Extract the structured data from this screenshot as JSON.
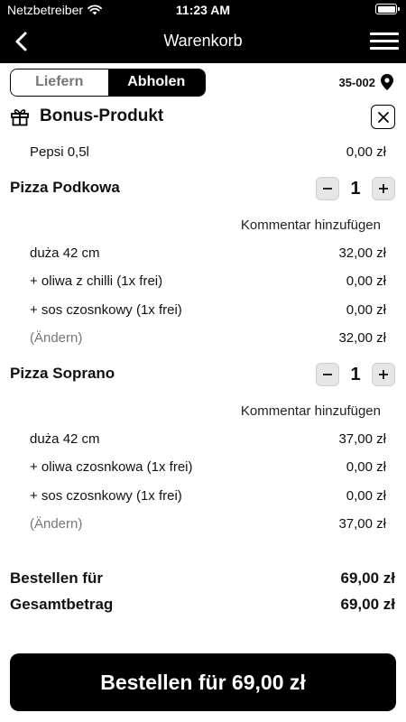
{
  "status": {
    "carrier": "Netzbetreiber",
    "time": "11:23 AM"
  },
  "nav": {
    "title": "Warenkorb"
  },
  "mode": {
    "deliver": "Liefern",
    "pickup": "Abholen",
    "selected": "pickup",
    "postal_code": "35-002"
  },
  "bonus": {
    "title": "Bonus-Produkt",
    "item": {
      "name": "Pepsi 0,5l",
      "price": "0,00 zł"
    }
  },
  "products": [
    {
      "name": "Pizza Podkowa",
      "qty": "1",
      "comment": "Kommentar hinzufügen",
      "lines": [
        {
          "label": "duża 42 cm",
          "price": "32,00 zł"
        },
        {
          "label": "+ oliwa z chilli (1x frei)",
          "price": "0,00 zł"
        },
        {
          "label": "+ sos czosnkowy (1x frei)",
          "price": "0,00 zł"
        },
        {
          "label": "(Ändern)",
          "price": "32,00 zł"
        }
      ]
    },
    {
      "name": "Pizza Soprano",
      "qty": "1",
      "comment": "Kommentar hinzufügen",
      "lines": [
        {
          "label": "duża 42 cm",
          "price": "37,00 zł"
        },
        {
          "label": "+ oliwa czosnkowa (1x frei)",
          "price": "0,00 zł"
        },
        {
          "label": "+ sos czosnkowy (1x frei)",
          "price": "0,00 zł"
        },
        {
          "label": "(Ändern)",
          "price": "37,00 zł"
        }
      ]
    }
  ],
  "totals": {
    "order_label": "Bestellen für",
    "order_value": "69,00 zł",
    "total_label": "Gesamtbetrag",
    "total_value": "69,00 zł"
  },
  "cta": {
    "label": "Bestellen für 69,00 zł"
  },
  "icons": {
    "wifi": "wifi-icon",
    "battery": "battery-icon",
    "back": "chevron-left-icon",
    "menu": "hamburger-menu-icon",
    "location": "location-pin-icon",
    "gift": "gift-icon",
    "close": "close-icon",
    "minus": "minus-icon",
    "plus": "plus-icon"
  }
}
